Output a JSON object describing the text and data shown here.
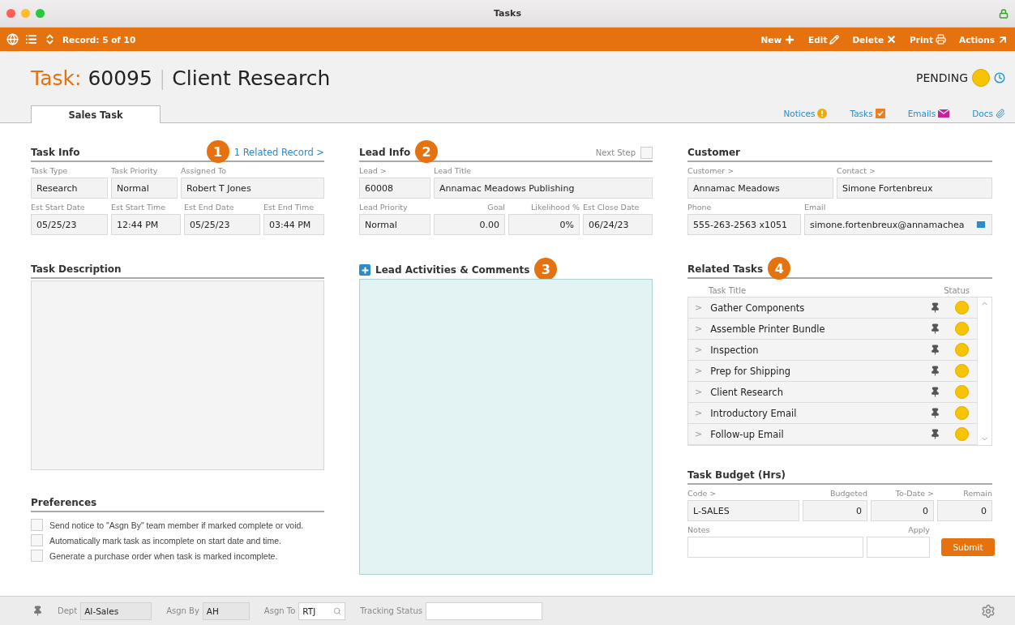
{
  "window": {
    "title": "Tasks"
  },
  "toolbar": {
    "record": "Record: 5 of 10",
    "actions": [
      {
        "label": "New",
        "kind": "new"
      },
      {
        "label": "Edit",
        "kind": "edit"
      },
      {
        "label": "Delete",
        "kind": "delete"
      },
      {
        "label": "Print",
        "kind": "print"
      },
      {
        "label": "Actions",
        "kind": "actions"
      }
    ]
  },
  "header": {
    "prefix": "Task:",
    "number": "60095",
    "separator": "|",
    "name": "Client Research",
    "status": "PENDING"
  },
  "tabs": [
    {
      "label": "Sales Task",
      "selected": true
    }
  ],
  "links": [
    {
      "label": "Notices",
      "kind": "notices"
    },
    {
      "label": "Tasks",
      "kind": "tasks"
    },
    {
      "label": "Emails",
      "kind": "emails"
    },
    {
      "label": "Docs",
      "kind": "docs"
    }
  ],
  "task_info": {
    "title": "Task Info",
    "badge": "1",
    "link": "1 Related Record >",
    "rows": [
      [
        {
          "label": "Task Type",
          "value": "Research",
          "kind": "text"
        },
        {
          "label": "Task Priority",
          "value": "Normal",
          "kind": "text"
        },
        {
          "label": "Assigned To",
          "value": "Robert T Jones",
          "kind": "text"
        }
      ],
      [
        {
          "label": "Est Start Date",
          "value": "05/25/23",
          "kind": "text"
        },
        {
          "label": "Est Start Time",
          "value": "12:44 PM",
          "kind": "text"
        },
        {
          "label": "Est End Date",
          "value": "05/25/23",
          "kind": "text"
        },
        {
          "label": "Est End Time",
          "value": "03:44 PM",
          "kind": "text"
        }
      ]
    ]
  },
  "task_description": {
    "title": "Task Description"
  },
  "preferences": {
    "title": "Preferences",
    "options": [
      {
        "label": "Send notice to \"Asgn By\" team member if marked complete or void.",
        "checked": false
      },
      {
        "label": "Automatically mark task as incomplete on start date and time.",
        "checked": false
      },
      {
        "label": "Generate a purchase order when task is marked incomplete.",
        "checked": false
      }
    ]
  },
  "lead_info": {
    "title": "Lead Info",
    "badge": "2",
    "next_step": {
      "label": "Next Step",
      "checked": false
    },
    "rows": [
      [
        {
          "label": "Lead >",
          "value": "60008",
          "kind": "text"
        },
        {
          "label": "Lead Title",
          "value": "Annamac Meadows Publishing",
          "kind": "text"
        }
      ],
      [
        {
          "label": "Lead Priority",
          "value": "Normal",
          "kind": "text"
        },
        {
          "label": "Goal",
          "value": "0.00",
          "kind": "number"
        },
        {
          "label": "Likelihood %",
          "value": "0%",
          "kind": "number"
        },
        {
          "label": "Est Close Date",
          "value": "06/24/23",
          "kind": "text"
        }
      ]
    ]
  },
  "lead_activities": {
    "title": "Lead Activities & Comments",
    "badge": "3"
  },
  "customer": {
    "title": "Customer",
    "rows": [
      [
        {
          "label": "Customer >",
          "value": "Annamac Meadows",
          "kind": "text"
        },
        {
          "label": "Contact >",
          "value": "Simone Fortenbreux",
          "kind": "text"
        }
      ],
      [
        {
          "label": "Phone",
          "value": "555-263-2563 x1051",
          "kind": "text"
        },
        {
          "label": "Email",
          "value": "simone.fortenbreux@annamachea",
          "kind": "email"
        }
      ]
    ]
  },
  "related_tasks": {
    "title": "Related Tasks",
    "badge": "4",
    "columns": [
      "Task Title",
      "Status"
    ],
    "rows": [
      {
        "expander": ">",
        "title": "Gather Components"
      },
      {
        "expander": ">",
        "title": "Assemble Printer Bundle"
      },
      {
        "expander": ">",
        "title": "Inspection"
      },
      {
        "expander": ">",
        "title": "Prep for Shipping"
      },
      {
        "expander": ">",
        "title": "Client Research"
      },
      {
        "expander": ">",
        "title": "Introductory Email"
      },
      {
        "expander": ">",
        "title": "Follow-up Email"
      }
    ]
  },
  "task_budget": {
    "title": "Task Budget (Hrs)",
    "fields": [
      {
        "label": "Code >",
        "value": "L-SALES",
        "kind": "text"
      },
      {
        "label": "Budgeted",
        "value": "0",
        "kind": "number"
      },
      {
        "label": "To-Date >",
        "value": "0",
        "kind": "number"
      },
      {
        "label": "Remain",
        "value": "0",
        "kind": "number"
      }
    ],
    "notes": {
      "label": "Notes",
      "kind": "input"
    },
    "apply": {
      "label": "Apply",
      "kind": "input_number"
    },
    "submit": "Submit"
  },
  "footer": {
    "fields": [
      {
        "label": "Dept",
        "value": "AI-Sales",
        "kind": "readonly"
      },
      {
        "label": "Asgn By",
        "value": "AH",
        "kind": "readonly"
      },
      {
        "label": "Asgn To",
        "value": "RTJ",
        "kind": "lookup"
      },
      {
        "label": "Tracking Status",
        "kind": "input"
      }
    ]
  }
}
